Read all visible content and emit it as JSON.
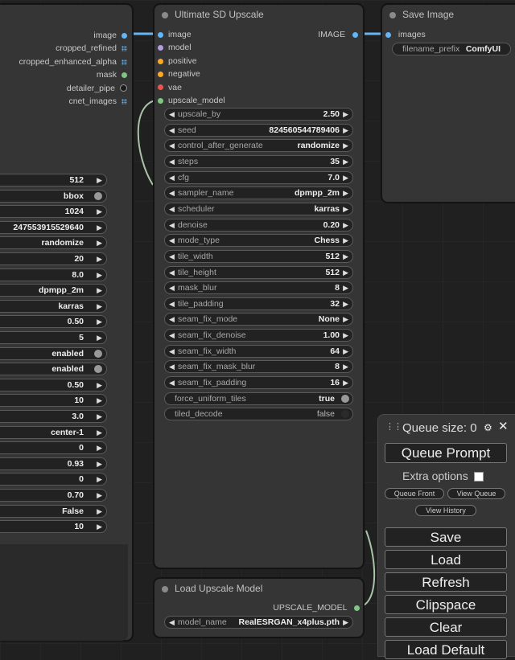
{
  "left_node": {
    "outputs": [
      {
        "label": "image",
        "color": "#64b5f6",
        "shape": "dot"
      },
      {
        "label": "cropped_refined",
        "color": "#64b5f6",
        "shape": "grid"
      },
      {
        "label": "cropped_enhanced_alpha",
        "color": "#64b5f6",
        "shape": "grid"
      },
      {
        "label": "mask",
        "color": "#81c784",
        "shape": "dot"
      },
      {
        "label": "detailer_pipe",
        "color": "#1a1a1a",
        "shape": "dot"
      },
      {
        "label": "cnet_images",
        "color": "#64b5f6",
        "shape": "grid"
      }
    ],
    "widgets": [
      {
        "value": "512",
        "kind": "arrow"
      },
      {
        "value": "bbox",
        "kind": "toggle-on"
      },
      {
        "value": "1024",
        "kind": "arrow"
      },
      {
        "value": "247553915529640",
        "kind": "arrow"
      },
      {
        "value": "randomize",
        "kind": "arrow"
      },
      {
        "value": "20",
        "kind": "arrow"
      },
      {
        "value": "8.0",
        "kind": "arrow"
      },
      {
        "value": "dpmpp_2m",
        "kind": "arrow"
      },
      {
        "value": "karras",
        "kind": "arrow"
      },
      {
        "value": "0.50",
        "kind": "arrow"
      },
      {
        "value": "5",
        "kind": "arrow"
      },
      {
        "value": "enabled",
        "kind": "toggle-on"
      },
      {
        "value": "enabled",
        "kind": "toggle-on"
      },
      {
        "value": "0.50",
        "kind": "arrow"
      },
      {
        "value": "10",
        "kind": "arrow"
      },
      {
        "value": "3.0",
        "kind": "arrow"
      },
      {
        "value": "center-1",
        "kind": "arrow"
      },
      {
        "value": "0",
        "kind": "arrow"
      },
      {
        "value": "0.93",
        "kind": "arrow"
      },
      {
        "value": "0",
        "kind": "arrow"
      },
      {
        "value": "0.70",
        "kind": "arrow"
      },
      {
        "value": "False",
        "kind": "arrow"
      },
      {
        "value": "10",
        "kind": "arrow"
      }
    ]
  },
  "upscale_node": {
    "title": "Ultimate SD Upscale",
    "inputs": [
      {
        "label": "image",
        "color": "#64b5f6"
      },
      {
        "label": "model",
        "color": "#b39ddb"
      },
      {
        "label": "positive",
        "color": "#ffa726"
      },
      {
        "label": "negative",
        "color": "#ffa726"
      },
      {
        "label": "vae",
        "color": "#ef5350"
      },
      {
        "label": "upscale_model",
        "color": "#81c784"
      }
    ],
    "output": {
      "label": "IMAGE",
      "color": "#64b5f6"
    },
    "widgets": [
      {
        "label": "upscale_by",
        "value": "2.50",
        "kind": "arrow"
      },
      {
        "label": "seed",
        "value": "824560544789406",
        "kind": "arrow"
      },
      {
        "label": "control_after_generate",
        "value": "randomize",
        "kind": "arrow"
      },
      {
        "label": "steps",
        "value": "35",
        "kind": "arrow"
      },
      {
        "label": "cfg",
        "value": "7.0",
        "kind": "arrow"
      },
      {
        "label": "sampler_name",
        "value": "dpmpp_2m",
        "kind": "arrow"
      },
      {
        "label": "scheduler",
        "value": "karras",
        "kind": "arrow"
      },
      {
        "label": "denoise",
        "value": "0.20",
        "kind": "arrow"
      },
      {
        "label": "mode_type",
        "value": "Chess",
        "kind": "arrow"
      },
      {
        "label": "tile_width",
        "value": "512",
        "kind": "arrow"
      },
      {
        "label": "tile_height",
        "value": "512",
        "kind": "arrow"
      },
      {
        "label": "mask_blur",
        "value": "8",
        "kind": "arrow"
      },
      {
        "label": "tile_padding",
        "value": "32",
        "kind": "arrow"
      },
      {
        "label": "seam_fix_mode",
        "value": "None",
        "kind": "arrow"
      },
      {
        "label": "seam_fix_denoise",
        "value": "1.00",
        "kind": "arrow"
      },
      {
        "label": "seam_fix_width",
        "value": "64",
        "kind": "arrow"
      },
      {
        "label": "seam_fix_mask_blur",
        "value": "8",
        "kind": "arrow"
      },
      {
        "label": "seam_fix_padding",
        "value": "16",
        "kind": "arrow"
      },
      {
        "label": "force_uniform_tiles",
        "value": "true",
        "kind": "toggle-on"
      },
      {
        "label": "tiled_decode",
        "value": "false",
        "kind": "toggle-off"
      }
    ]
  },
  "save_node": {
    "title": "Save Image",
    "input": {
      "label": "images",
      "color": "#64b5f6"
    },
    "widget": {
      "label": "filename_prefix",
      "value": "ComfyUI"
    }
  },
  "load_node": {
    "title": "Load Upscale Model",
    "output": {
      "label": "UPSCALE_MODEL",
      "color": "#81c784"
    },
    "widget": {
      "label": "model_name",
      "value": "RealESRGAN_x4plus.pth"
    }
  },
  "queue_panel": {
    "title": "Queue size: 0",
    "queue_prompt": "Queue Prompt",
    "extra_options": "Extra options",
    "queue_front": "Queue Front",
    "view_queue": "View Queue",
    "view_history": "View History",
    "save": "Save",
    "load": "Load",
    "refresh": "Refresh",
    "clipspace": "Clipspace",
    "clear": "Clear",
    "load_default": "Load Default"
  },
  "colors": {
    "image_link": "#64b5f6",
    "upscale_model_link": "#a7c4a8",
    "node_bg": "#353535",
    "canvas_bg": "#202020"
  }
}
